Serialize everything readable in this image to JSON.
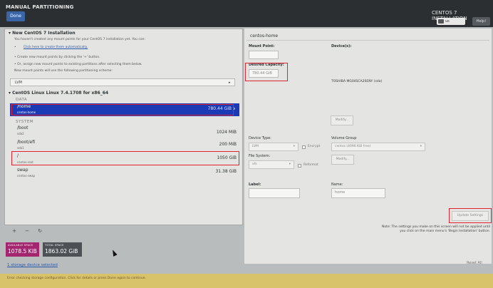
{
  "header": {
    "title": "MANUAL PARTITIONING",
    "done_label": "Done",
    "product": "CENTOS 7 INSTALLATION",
    "keyboard": "us",
    "help_label": "Help!"
  },
  "left": {
    "new_title": "New CentOS 7 Installation",
    "new_desc": "You haven't created any mount points for your CentOS 7 installation yet.  You can:",
    "auto_link": "Click here to create them automatically.",
    "bullet1": "Create new mount points by clicking the '+' button.",
    "bullet2": "Or, assign new mount points to existing partitions after selecting them below.",
    "scheme_text": "New mount points will use the following partitioning scheme:",
    "scheme_value": "LVM",
    "linux_title": "CentOS Linux Linux 7.4.1708 for x86_64",
    "data_label": "DATA",
    "system_label": "SYSTEM",
    "data_rows": [
      {
        "name": "/home",
        "device": "centos-home",
        "size": "780.44 GiB"
      }
    ],
    "system_rows": [
      {
        "name": "/boot",
        "device": "sda2",
        "size": "1024 MiB"
      },
      {
        "name": "/boot/efi",
        "device": "sda1",
        "size": "200 MiB"
      },
      {
        "name": "/",
        "device": "centos-root",
        "size": "1050 GiB"
      },
      {
        "name": "swap",
        "device": "centos-swap",
        "size": "31.38 GiB"
      }
    ],
    "add_btn": "+",
    "remove_btn": "−",
    "refresh_btn": "↻"
  },
  "space": {
    "available_label": "AVAILABLE SPACE",
    "available_value": "1078.5 KiB",
    "total_label": "TOTAL SPACE",
    "total_value": "1863.02 GiB",
    "storage_link": "1 storage device selected"
  },
  "right": {
    "title": "centos-home",
    "mount_label": "Mount Point:",
    "mount_value": "",
    "devices_label": "Device(s):",
    "capacity_label": "Desired Capacity:",
    "capacity_value": "780.44 GiB",
    "device_name": "TOSHIBA MG04SCA20ENY (sda)",
    "modify1": "Modify...",
    "devtype_label": "Device Type:",
    "devtype_value": "LVM",
    "encrypt_label": "Encrypt",
    "vg_label": "Volume Group",
    "vg_value": "centos        (4096 KiB free)",
    "modify2": "Modify...",
    "fs_label": "File System:",
    "fs_value": "xfs",
    "reformat_label": "Reformat",
    "label_label": "Label:",
    "name_label": "Name:",
    "name_value": "home",
    "update_label": "Update Settings",
    "note": "Note:  The settings you make on this screen will not be applied until you click on the main menu's 'Begin Installation' button.",
    "reset_label": "Reset All"
  },
  "status": {
    "text": "Error checking storage configuration.  Click for details or press Done again to continue."
  },
  "colors": {
    "selected_row": "#1a3bb5",
    "available": "#a3266f",
    "total": "#4d5155",
    "highlight": "#e0232f",
    "warning_bar": "#d8c36a"
  }
}
